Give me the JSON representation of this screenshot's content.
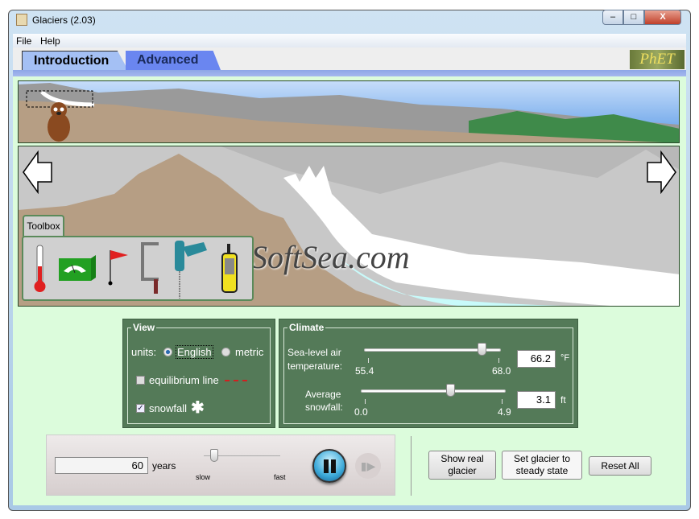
{
  "window": {
    "title": "Glaciers (2.03)",
    "minimize": "–",
    "maximize": "□",
    "close": "X"
  },
  "menu": [
    "File",
    "Help"
  ],
  "tabs": [
    {
      "label": "Introduction",
      "active": true
    },
    {
      "label": "Advanced",
      "active": false
    }
  ],
  "logo": "PhET",
  "watermark": "SoftSea.com",
  "toolbox": {
    "label": "Toolbox",
    "tools": [
      "thermometer",
      "glacial-budget-meter",
      "flag",
      "borehole-clamp",
      "drill",
      "gps-receiver"
    ]
  },
  "view": {
    "title": "View",
    "units_label": "units:",
    "units_options": [
      "English",
      "metric"
    ],
    "units_selected": "English",
    "equilibrium_label": "equilibrium line",
    "equilibrium_checked": false,
    "snowfall_label": "snowfall",
    "snowfall_checked": true
  },
  "climate": {
    "title": "Climate",
    "temperature": {
      "label_line1": "Sea-level air",
      "label_line2": "temperature:",
      "min": "55.4",
      "max": "68.0",
      "value": "66.2",
      "unit": "°F"
    },
    "snowfall": {
      "label_line1": "Average",
      "label_line2": "snowfall:",
      "min": "0.0",
      "max": "4.9",
      "value": "3.1",
      "unit": "ft"
    }
  },
  "clock": {
    "years_value": "60",
    "years_label": "years",
    "slow_label": "slow",
    "fast_label": "fast",
    "speed_fraction": 0.1,
    "state": "running"
  },
  "buttons": {
    "show_real": [
      "Show real",
      "glacier"
    ],
    "steady": [
      "Set glacier to",
      "steady state"
    ],
    "reset": "Reset All"
  },
  "colors": {
    "panel": "#547a58",
    "background": "#dcfcdc",
    "tab_active": "#a4c0f4",
    "tab_inactive": "#6a86f0"
  }
}
